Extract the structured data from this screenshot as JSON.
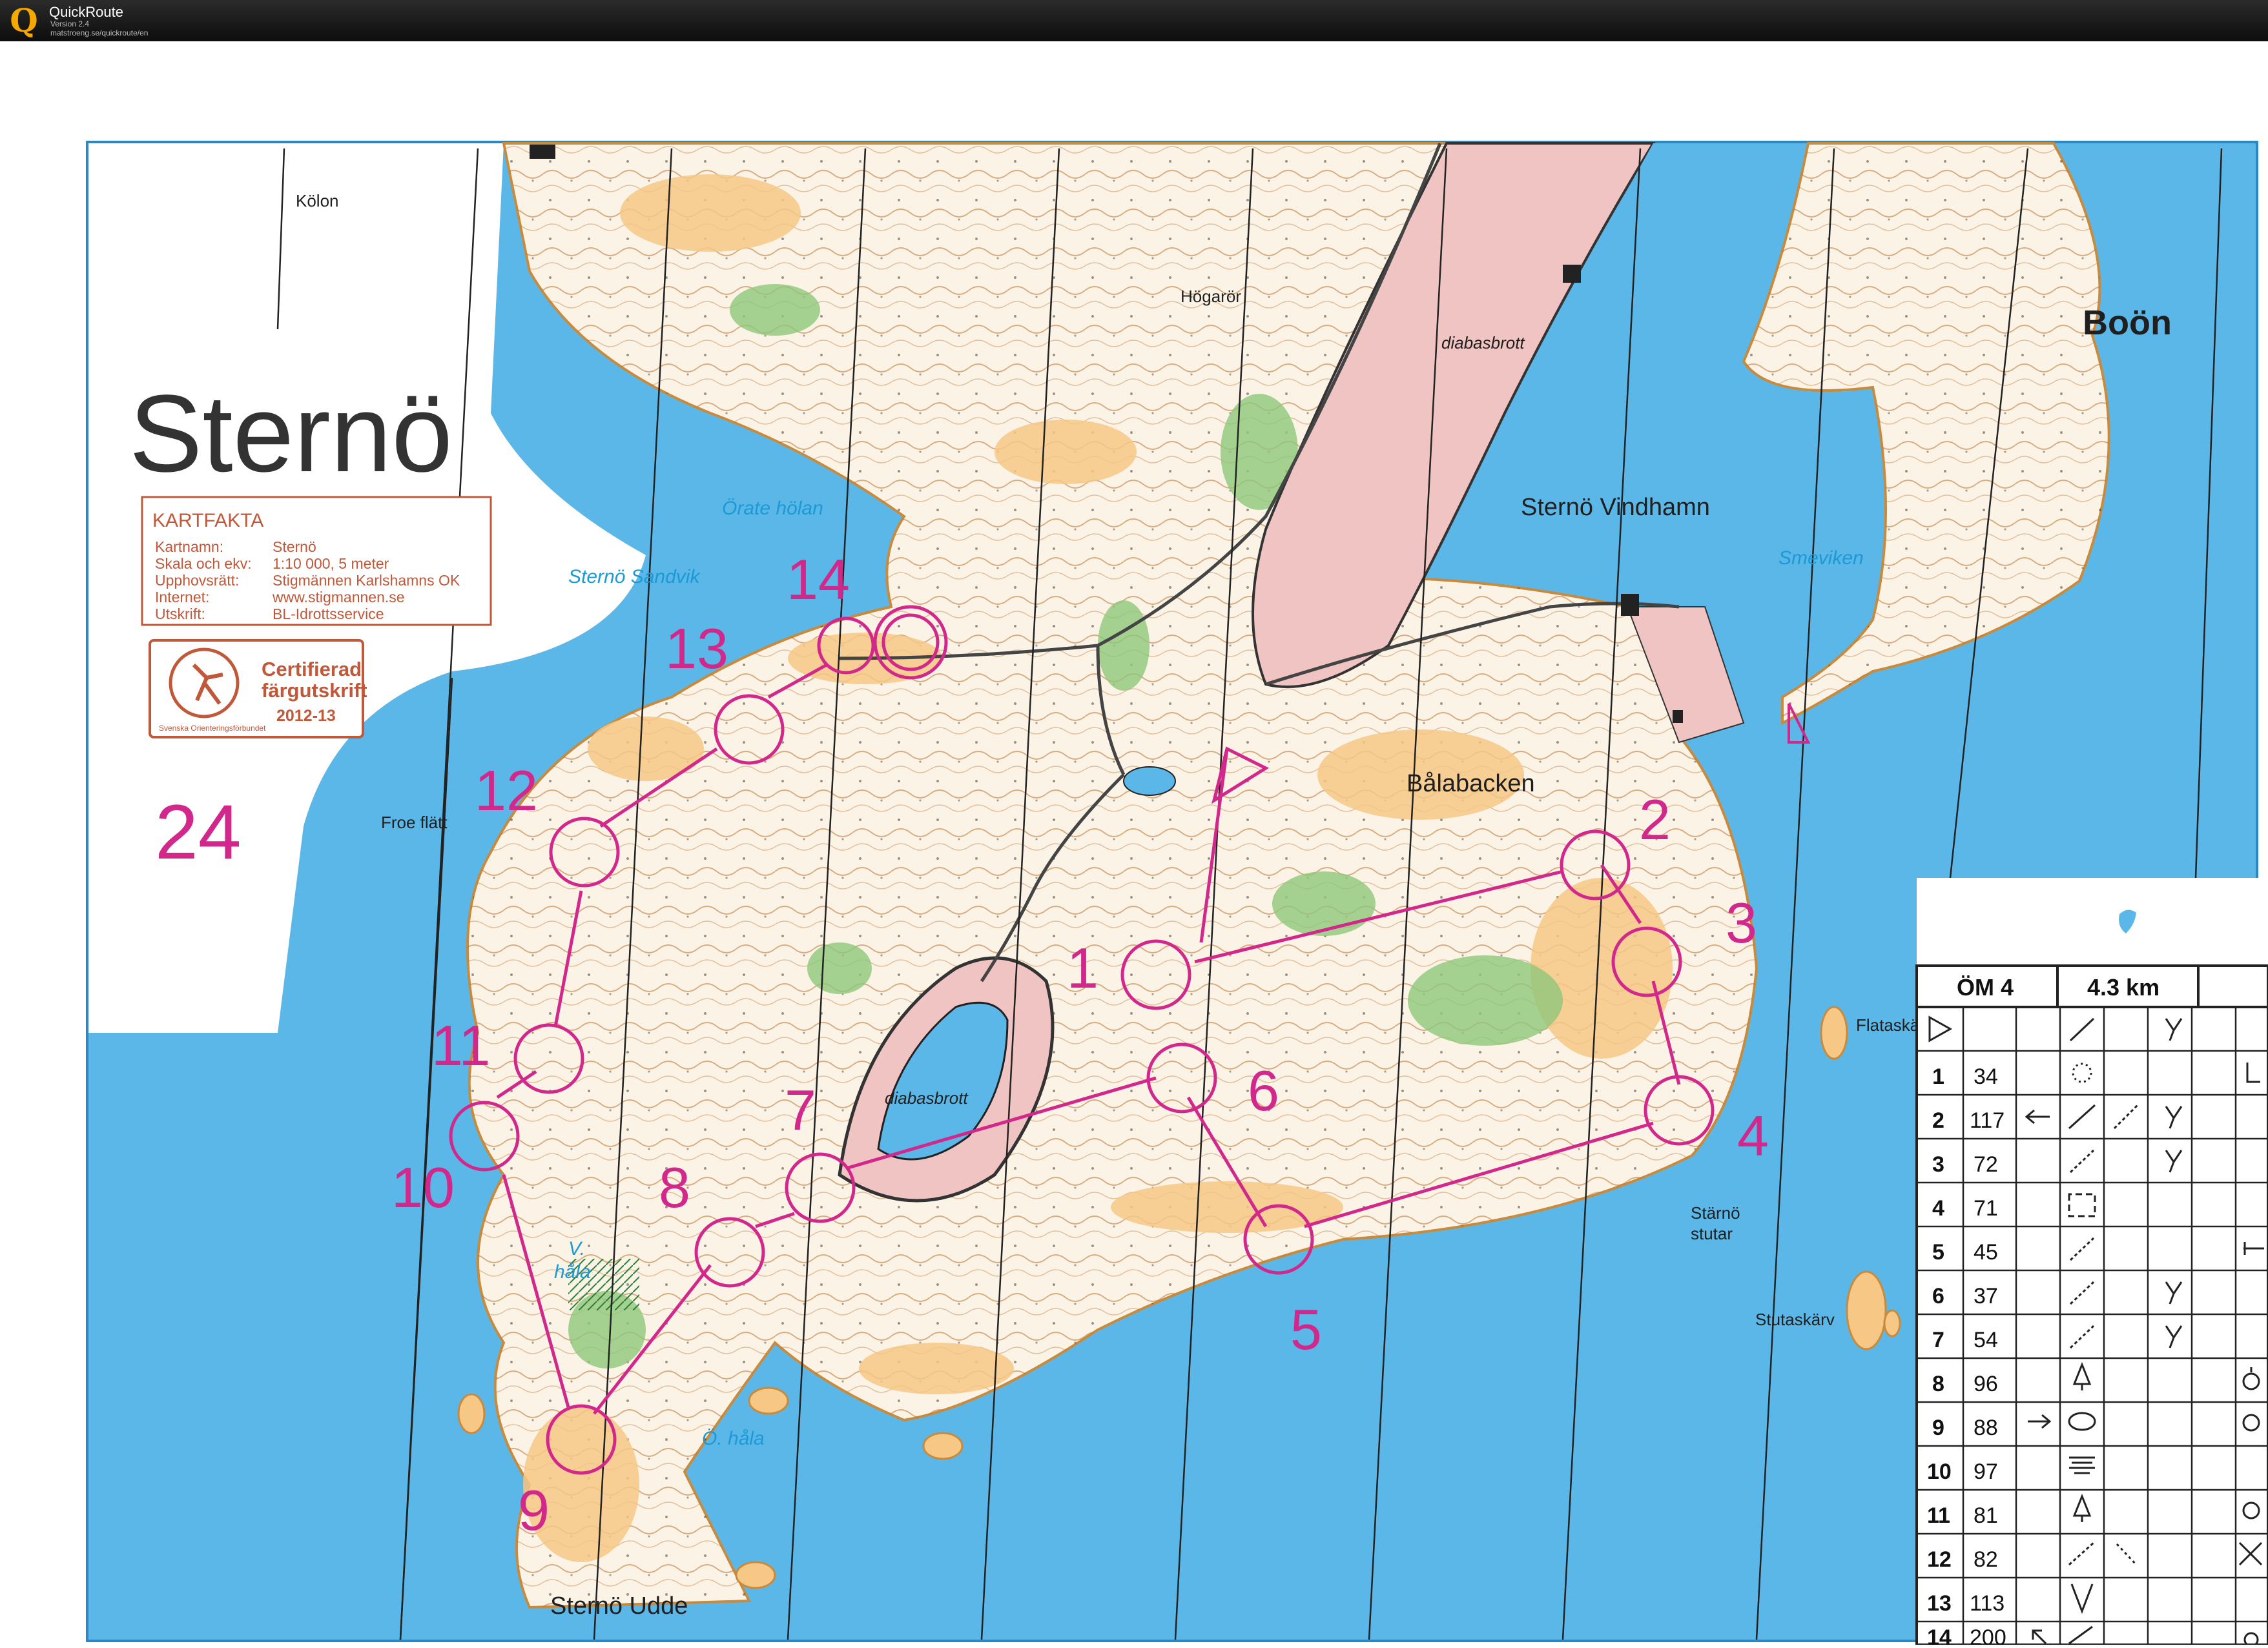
{
  "app": {
    "title": "QuickRoute",
    "version": "Version 2.4",
    "url": "matstroeng.se/quickroute/en",
    "logo": "Q"
  },
  "map": {
    "title": "Sternö",
    "event_number": "24",
    "colors": {
      "water": "#5bb7e8",
      "land": "#fbf3e6",
      "open_land": "#f6c785",
      "green": "#8fc77a",
      "quarry": "#f0c4c2",
      "course": "#d2288b",
      "contour": "#b9712c"
    },
    "kartfakta": {
      "heading": "KARTFAKTA",
      "rows": [
        {
          "label": "Kartnamn:",
          "value": "Sternö"
        },
        {
          "label": "Skala och ekv:",
          "value": "1:10 000, 5 meter"
        },
        {
          "label": "Upphovsrätt:",
          "value": "Stigmännen Karlshamns OK"
        },
        {
          "label": "Internet:",
          "value": "www.stigmannen.se"
        },
        {
          "label": "Utskrift:",
          "value": "BL-Idrottsservice"
        }
      ]
    },
    "certificate": {
      "line1": "Certifierad",
      "line2": "färgutskrift",
      "year": "2012-13",
      "org": "Svenska Orienteringsförbundet"
    },
    "place_names": {
      "kolon": "Kölon",
      "hogaror": "Högarör",
      "diabasbrott_top": "diabasbrott",
      "boon": "Boön",
      "sterno_vindhamn": "Sternö Vindhamn",
      "smeviken": "Smeviken",
      "orate_holan": "Örate hölan",
      "sterno_sandvik": "Sternö Sandvik",
      "balabacken": "Bålabacken",
      "froe_flatt": "Froe flätt",
      "diabasbrott_pit": "diabasbrott",
      "flataskar": "Flataskä",
      "starno_stutar_1": "Stärnö",
      "starno_stutar_2": "stutar",
      "stutaskarv": "Stutaskärv",
      "v_hala_1": "V.",
      "v_hala_2": "håla",
      "o_hala": "Ö. håla",
      "sterno_udde": "Sternö Udde"
    },
    "controls": [
      {
        "number": "1"
      },
      {
        "number": "2"
      },
      {
        "number": "3"
      },
      {
        "number": "4"
      },
      {
        "number": "5"
      },
      {
        "number": "6"
      },
      {
        "number": "7"
      },
      {
        "number": "8"
      },
      {
        "number": "9"
      },
      {
        "number": "10"
      },
      {
        "number": "11"
      },
      {
        "number": "12"
      },
      {
        "number": "13"
      },
      {
        "number": "14"
      }
    ]
  },
  "description_sheet": {
    "class_name": "ÖM 4",
    "length": "4.3 km",
    "rows": [
      {
        "num": "1",
        "code": "34"
      },
      {
        "num": "2",
        "code": "117"
      },
      {
        "num": "3",
        "code": "72"
      },
      {
        "num": "4",
        "code": "71"
      },
      {
        "num": "5",
        "code": "45"
      },
      {
        "num": "6",
        "code": "37"
      },
      {
        "num": "7",
        "code": "54"
      },
      {
        "num": "8",
        "code": "96"
      },
      {
        "num": "9",
        "code": "88"
      },
      {
        "num": "10",
        "code": "97"
      },
      {
        "num": "11",
        "code": "81"
      },
      {
        "num": "12",
        "code": "82"
      },
      {
        "num": "13",
        "code": "113"
      },
      {
        "num": "14",
        "code": "200"
      }
    ]
  }
}
